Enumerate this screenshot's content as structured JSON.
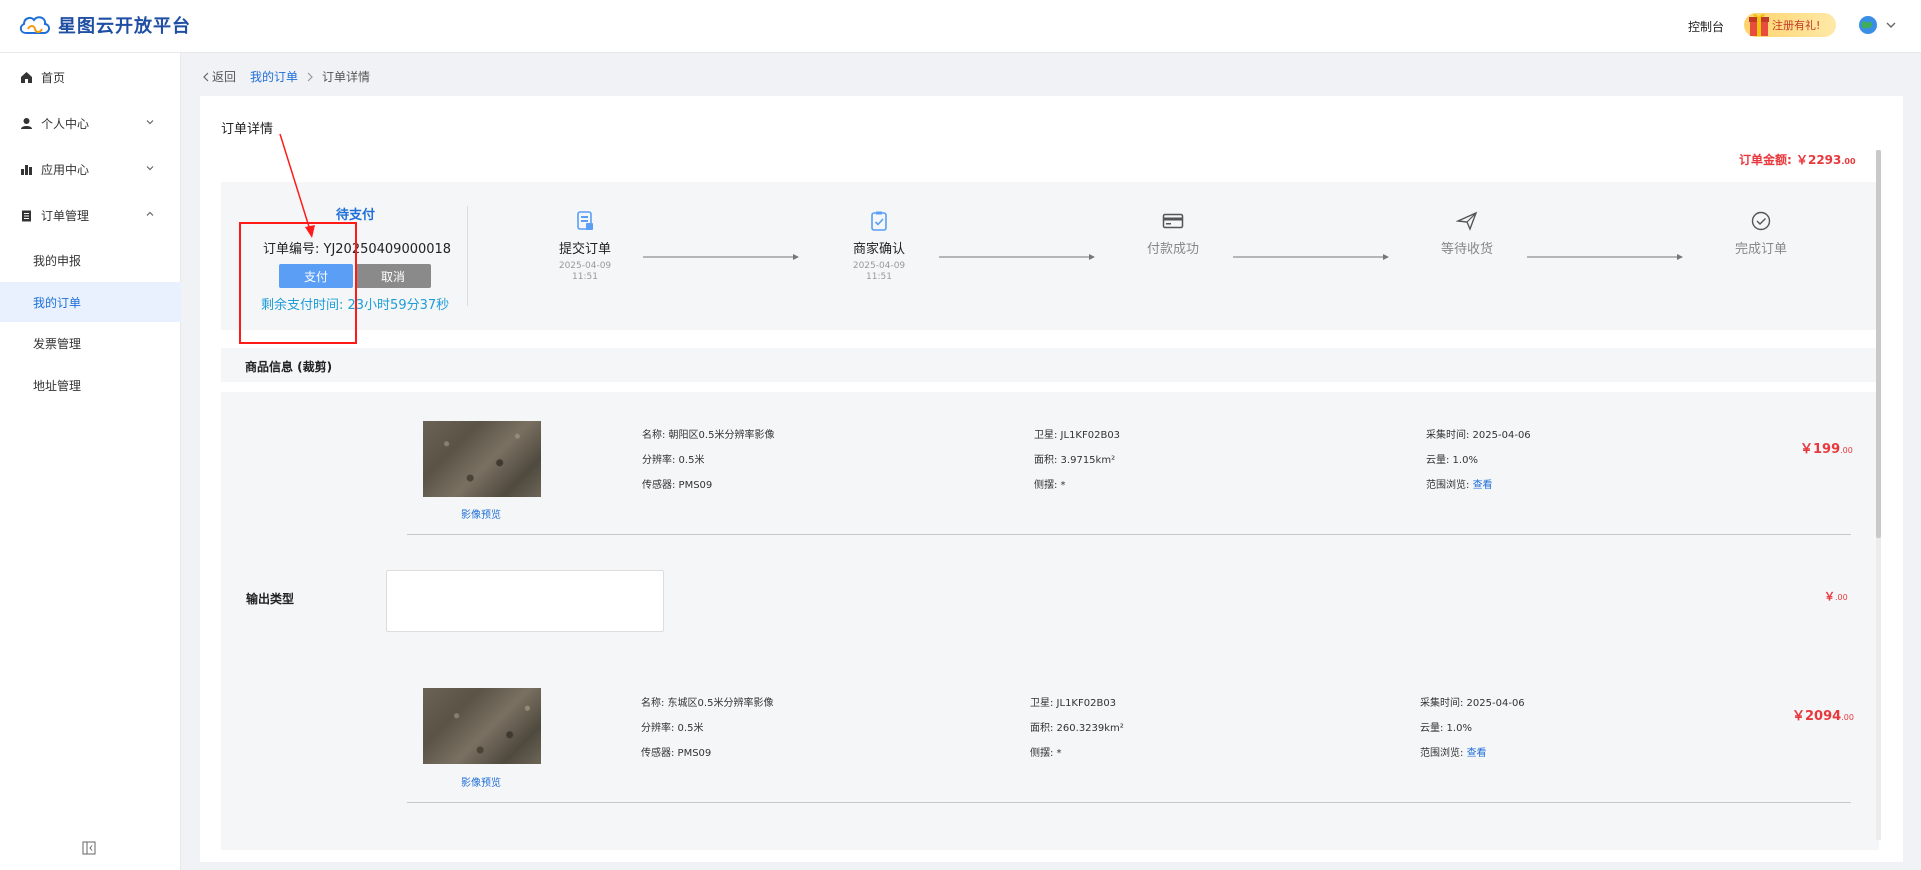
{
  "header": {
    "logo_text": "星图云开放平台",
    "console": "控制台",
    "gift": "注册有礼!"
  },
  "sidebar": {
    "items": [
      {
        "label": "首页"
      },
      {
        "label": "个人中心"
      },
      {
        "label": "应用中心"
      },
      {
        "label": "订单管理"
      }
    ],
    "sub_items": [
      {
        "label": "我的申报"
      },
      {
        "label": "我的订单"
      },
      {
        "label": "发票管理"
      },
      {
        "label": "地址管理"
      }
    ]
  },
  "breadcrumb": {
    "back": "返回",
    "parent": "我的订单",
    "current": "订单详情"
  },
  "card": {
    "title": "订单详情",
    "amount_label": "订单金额: ￥2293",
    "amount_decimal": ".00"
  },
  "status": {
    "title": "待支付",
    "order_no": "订单编号: YJ20250409000018",
    "pay": "支付",
    "cancel": "取消",
    "remain": "剩余支付时间: 23小时59分37秒",
    "steps": [
      {
        "name": "提交订单",
        "date": "2025-04-09",
        "time": "11:51"
      },
      {
        "name": "商家确认",
        "date": "2025-04-09",
        "time": "11:51"
      },
      {
        "name": "付款成功",
        "date": "",
        "time": ""
      },
      {
        "name": "等待收货",
        "date": "",
        "time": ""
      },
      {
        "name": "完成订单",
        "date": "",
        "time": ""
      }
    ]
  },
  "goods": {
    "header": "商品信息 (裁剪)",
    "preview": "影像预览",
    "output_type": "输出类型",
    "output_price": "￥",
    "output_price_decimal": ".00",
    "items": [
      {
        "name": "名称: 朝阳区0.5米分辨率影像",
        "resolution": "分辨率: 0.5米",
        "sensor": "传感器: PMS09",
        "satellite": "卫星: JL1KF02B03",
        "area": "面积: 3.9715km²",
        "swing": "侧摆: *",
        "collect_time": "采集时间: 2025-04-06",
        "cloud": "云量: 1.0%",
        "range_label": "范围浏览:",
        "range_link": "查看",
        "price": "￥199",
        "price_decimal": ".00"
      },
      {
        "name": "名称: 东城区0.5米分辨率影像",
        "resolution": "分辨率: 0.5米",
        "sensor": "传感器: PMS09",
        "satellite": "卫星: JL1KF02B03",
        "area": "面积: 260.3239km²",
        "swing": "侧摆: *",
        "collect_time": "采集时间: 2025-04-06",
        "cloud": "云量: 1.0%",
        "range_label": "范围浏览:",
        "range_link": "查看",
        "price": "￥2094",
        "price_decimal": ".00"
      }
    ]
  },
  "colors": {
    "accent": "#1f6fd8",
    "price": "#e8383d",
    "annotation": "#ff1a1a"
  }
}
